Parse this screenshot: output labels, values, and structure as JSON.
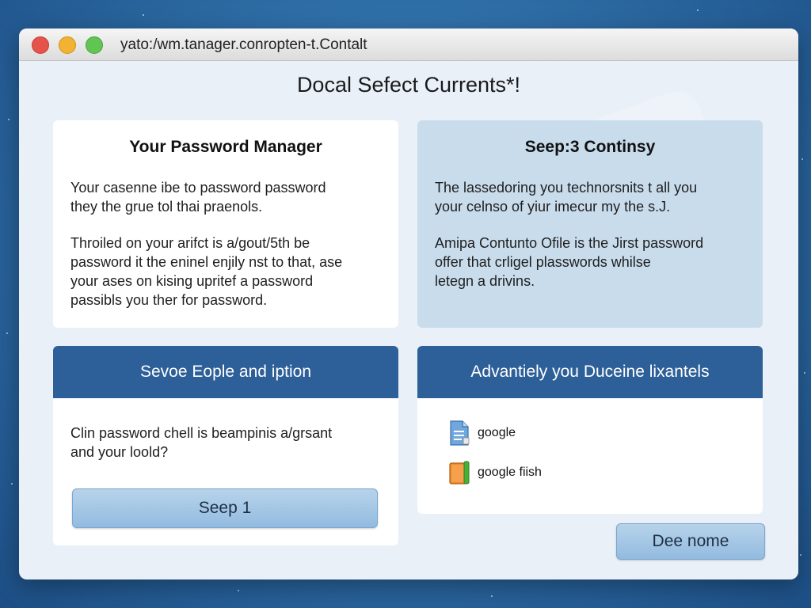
{
  "window": {
    "url": "yato:/wm.tanager.conropten-t.Contalt"
  },
  "page": {
    "heading": "Docal Sefect Currents*!"
  },
  "card_top_left": {
    "title": "Your Password Manager",
    "para1_line1": "Your casenne ibe to password password",
    "para1_line2": "they the grue tol thai praenols.",
    "para2_line1": "Throiled on your arifct is a/gout/5th be",
    "para2_line2": "password it the eninel enjily nst to that, ase",
    "para2_line3": "your ases on kising upritef a password",
    "para2_line4": "passibls you ther for password."
  },
  "card_top_right": {
    "title": "Seep:3 Continsy",
    "para1_line1": "The lassedoring you technorsnits t all you",
    "para1_line2": "your celnso of yiur imecur my the s.J.",
    "para2_line1": "Amipa Contunto Ofile is the Jirst password",
    "para2_line2": "offer that crligel plasswords whilse",
    "para2_line3": "letegn a drivins."
  },
  "card_bottom_left": {
    "header": "Sevoe Eople and iption",
    "text_line1": "Clin password chell is beampinis a/grsant",
    "text_line2": "and your loold?",
    "button": "Seep 1"
  },
  "card_bottom_right": {
    "header": "Advantiely you Duceine lixantels",
    "items": [
      {
        "label": "google",
        "icon": "document-icon"
      },
      {
        "label": "google fiish",
        "icon": "folder-icon"
      }
    ]
  },
  "footer": {
    "done_button": "Dee nome"
  },
  "colors": {
    "header_blue": "#2d5f98",
    "button_blue": "#a9c9e6"
  }
}
